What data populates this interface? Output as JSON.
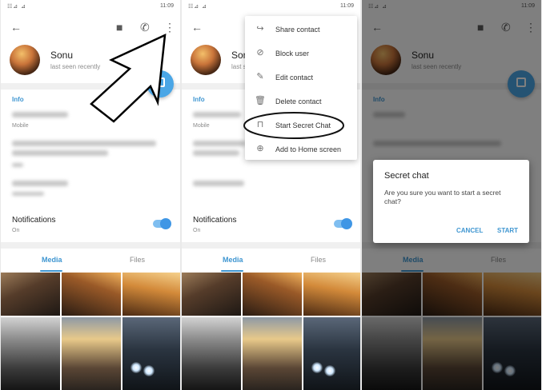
{
  "status": {
    "signal": "☷⊿ ⊿",
    "time": "11:09"
  },
  "contact": {
    "name": "Sonu",
    "last_seen": "last seen recently"
  },
  "info": {
    "title": "Info",
    "phone_label": "Mobile"
  },
  "notifications": {
    "title": "Notifications",
    "state": "On"
  },
  "tabs": {
    "media": "Media",
    "files": "Files"
  },
  "menu": {
    "items": [
      {
        "label": "Share contact",
        "icon": "share-icon"
      },
      {
        "label": "Block user",
        "icon": "block-icon"
      },
      {
        "label": "Edit contact",
        "icon": "pencil-icon"
      },
      {
        "label": "Delete contact",
        "icon": "trash-icon"
      },
      {
        "label": "Start Secret Chat",
        "icon": "lock-icon"
      },
      {
        "label": "Add to Home screen",
        "icon": "add-home-icon"
      }
    ]
  },
  "dialog": {
    "title": "Secret chat",
    "message": "Are you sure you want to start a secret chat?",
    "cancel": "CANCEL",
    "start": "START"
  },
  "colors": {
    "accent": "#3f96d1",
    "fab": "#4aa6e6"
  }
}
